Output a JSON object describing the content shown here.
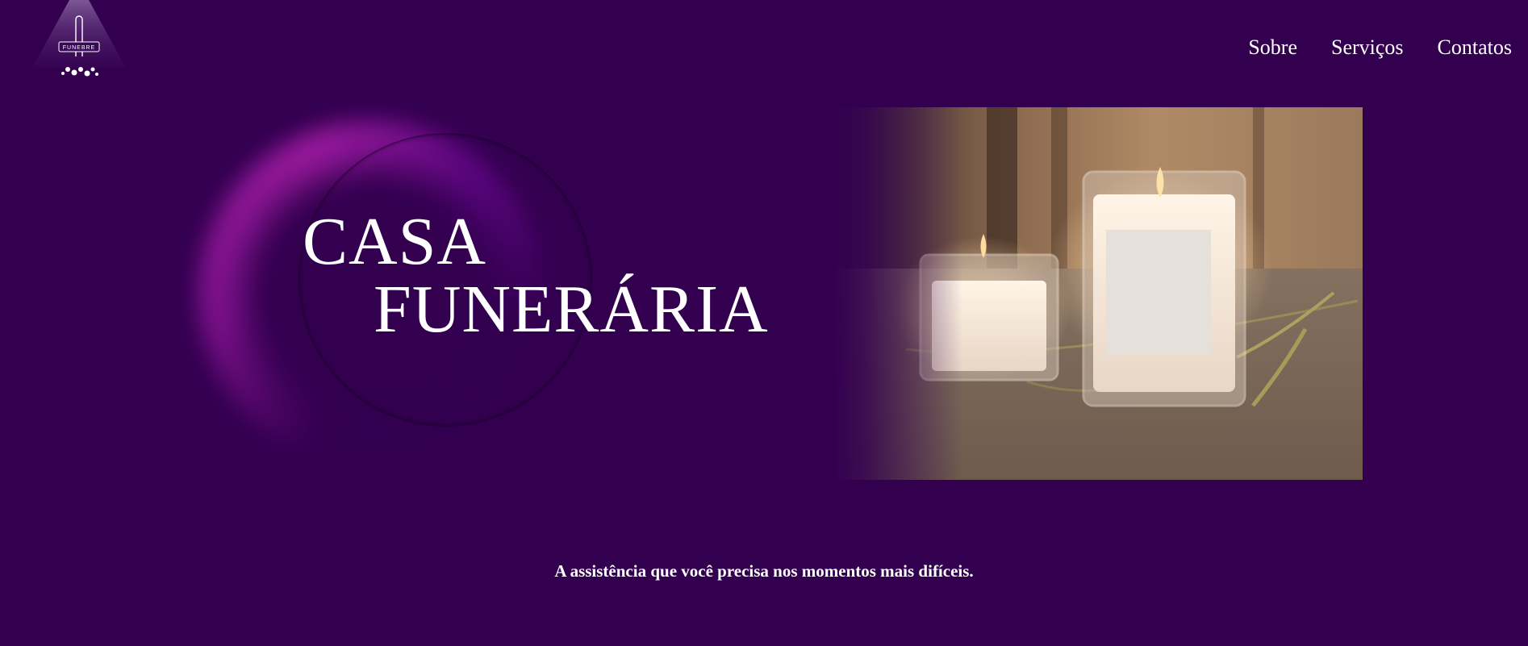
{
  "brand": {
    "logo_text": "FUNEBRE"
  },
  "nav": {
    "items": [
      "Sobre",
      "Serviços",
      "Contatos"
    ]
  },
  "hero": {
    "title_line1": "CASA",
    "title_line2": "FUNERÁRIA"
  },
  "tagline": "A assistência que você precisa nos momentos mais difíceis.",
  "colors": {
    "background": "#330050",
    "accent_glow": "#a01ea8",
    "text": "#ffffff"
  }
}
